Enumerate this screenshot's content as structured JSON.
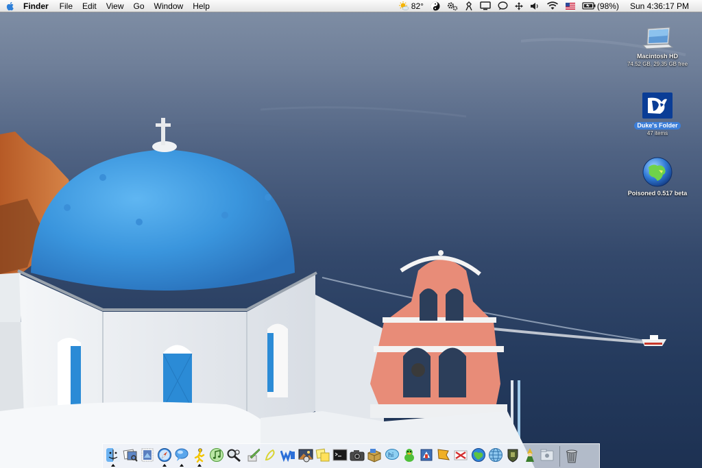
{
  "menubar": {
    "app_name": "Finder",
    "menus": [
      "File",
      "Edit",
      "View",
      "Go",
      "Window",
      "Help"
    ],
    "weather_temp": "82°",
    "battery_percent": "(98%)",
    "clock": "Sun 4:36:17 PM"
  },
  "desktop_icons": [
    {
      "label": "Macintosh HD",
      "sub": "74.52 GB, 29.35 GB free",
      "icon": "laptop-drive-icon"
    },
    {
      "label": "Duke's Folder",
      "sub": "47 items",
      "icon": "blue-devil-folder-icon",
      "selected": true
    },
    {
      "label": "Poisoned 0.517 beta",
      "sub": "",
      "icon": "globe-icon"
    }
  ],
  "dock": {
    "items": [
      "finder",
      "preview",
      "mail-stamp",
      "safari",
      "ichat",
      "aim",
      "itunes",
      "spotlight",
      "script-editor",
      "textedit",
      "word",
      "iphoto",
      "stickies",
      "terminal",
      "image-capture",
      "box-package",
      "bbedit",
      "adium",
      "frog-game",
      "flag",
      "stamp",
      "skype-toolbox",
      "earth",
      "globe",
      "armor",
      "wizard",
      "system-folder",
      "trash"
    ]
  }
}
